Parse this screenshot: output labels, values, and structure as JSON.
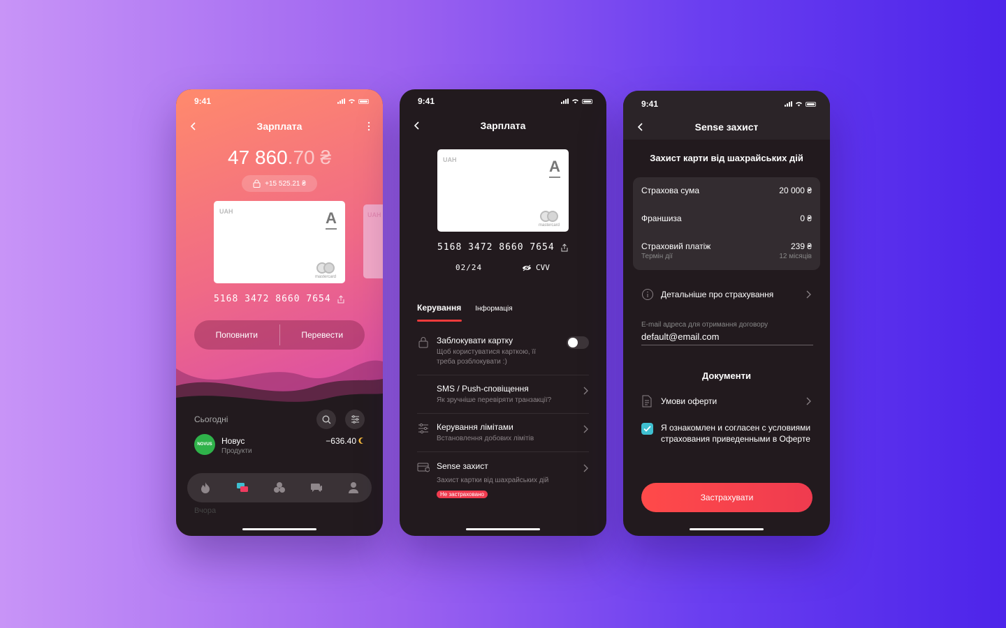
{
  "colors": {
    "accent": "#ef3b3b",
    "checkbox": "#3fbfd0",
    "novus": "#2fb24a",
    "dark_bg": "#221a1e"
  },
  "p1": {
    "time": "9:41",
    "title": "Зарплата",
    "balance_int": "47 860",
    "balance_dec": ".70 ₴",
    "locked_amount": "+15 525.21 ₴",
    "card_currency": "UAH",
    "card_bank": "A",
    "card_brand": "mastercard",
    "next_card_currency": "UAH",
    "card_number": "5168 3472 8660 7654",
    "topup_label": "Поповнити",
    "transfer_label": "Перевести",
    "today_label": "Сьогодні",
    "txn": {
      "logo": "NOVUS",
      "name": "Новус",
      "category": "Продукти",
      "amount": "−636.40"
    },
    "yesterday_label": "Вчора",
    "icons": {
      "back": "chevron-left-icon",
      "more": "more-vertical-icon",
      "search": "search-icon",
      "filter": "filter-icon",
      "lock": "lock-icon",
      "share": "share-icon",
      "cashback": "cashback-icon"
    },
    "tabbar": [
      "flame-icon",
      "cards-icon",
      "clover-icon",
      "chat-icon",
      "profile-icon"
    ]
  },
  "p2": {
    "time": "9:41",
    "title": "Зарплата",
    "card_currency": "UAH",
    "card_bank": "A",
    "card_brand": "mastercard",
    "card_number": "5168 3472 8660 7654",
    "expiry": "02/24",
    "cvv_label": "CVV",
    "tab_active": "Керування",
    "tab_inactive": "Інформація",
    "rows": [
      {
        "title": "Заблокувати картку",
        "sub": "Щоб користуватися карткою, її треба розблокувати :)"
      },
      {
        "title": "SMS / Push-сповіщення",
        "sub": "Як зручніше перевіряти транзакції?"
      },
      {
        "title": "Керування лімітами",
        "sub": "Встановлення добових лімітів"
      },
      {
        "title": "Sense захист",
        "sub": "Захист картки від шахрайських дій",
        "badge": "Не застраховано"
      }
    ]
  },
  "p3": {
    "time": "9:41",
    "title": "Sense захист",
    "heading": "Захист карти від шахрайських дій",
    "insured_label": "Страхова сума",
    "insured_value": "20 000 ₴",
    "deductible_label": "Франшиза",
    "deductible_value": "0 ₴",
    "payment_label": "Страховий платіж",
    "payment_value": "239 ₴",
    "term_label": "Термін дії",
    "term_value": "12 місяців",
    "more_label": "Детальніше про страхування",
    "email_label": "E-mail адреса для отримання договору",
    "email_value": "default@email.com",
    "docs_heading": "Документи",
    "offer_label": "Умови оферти",
    "agree_text": "Я ознакомлен и согласен с условиями страхования приведенными в Оферте",
    "cta_label": "Застрахувати"
  }
}
